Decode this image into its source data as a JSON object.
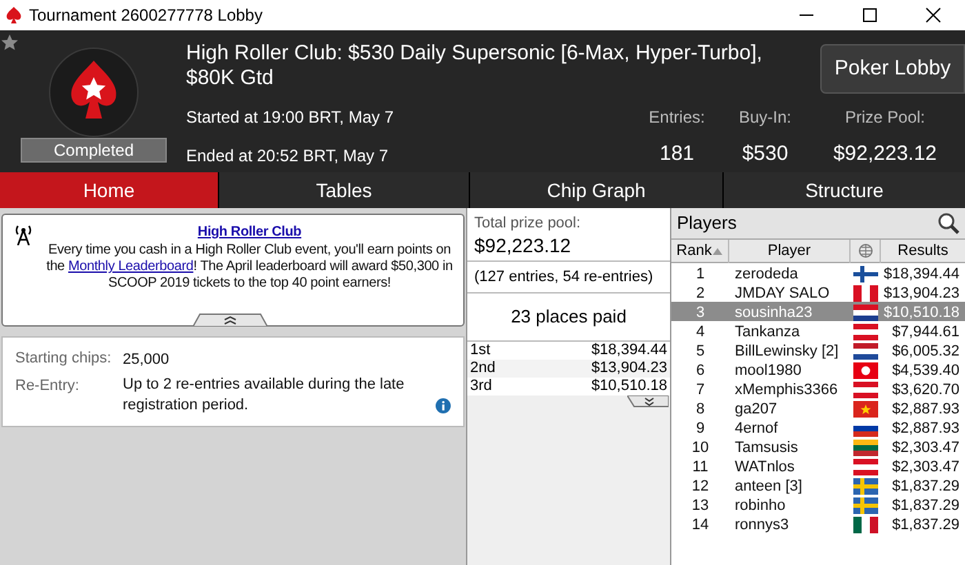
{
  "window": {
    "title": "Tournament 2600277778 Lobby"
  },
  "header": {
    "title": "High Roller Club: $530 Daily Supersonic [6-Max, Hyper-Turbo], $80K Gtd",
    "status": "Completed",
    "started": "Started at 19:00 BRT, May 7",
    "ended": "Ended at 20:52 BRT, May 7",
    "stats": [
      {
        "label": "Entries:",
        "value": "181"
      },
      {
        "label": "Buy-In:",
        "value": "$530"
      },
      {
        "label": "Prize Pool:",
        "value": "$92,223.12"
      }
    ],
    "lobby_button": "Poker Lobby"
  },
  "tabs": [
    {
      "label": "Home",
      "selected": true
    },
    {
      "label": "Tables",
      "selected": false
    },
    {
      "label": "Chip Graph",
      "selected": false
    },
    {
      "label": "Structure",
      "selected": false
    }
  ],
  "news": {
    "title": "High Roller Club",
    "parts": [
      "Every time you cash in a High Roller Club event, you'll earn points on the ",
      "Monthly Leaderboard",
      "! The April leaderboard will award $50,300 in SCOOP 2019 tickets to the top 40 point earners!"
    ]
  },
  "info": [
    {
      "label": "Starting chips:",
      "value": "25,000",
      "help": false
    },
    {
      "label": "Re-Entry:",
      "value": "Up to 2 re-entries available during the late registration period.",
      "help": true
    }
  ],
  "prizes": {
    "total_label": "Total prize pool:",
    "total": "$92,223.12",
    "entries": "(127 entries, 54 re-entries)",
    "places": "23 places paid",
    "rows": [
      {
        "place": "1st",
        "amount": "$18,394.44"
      },
      {
        "place": "2nd",
        "amount": "$13,904.23"
      },
      {
        "place": "3rd",
        "amount": "$10,510.18"
      }
    ]
  },
  "players": {
    "title": "Players",
    "columns": [
      "Rank",
      "Player",
      "Results"
    ],
    "rows": [
      {
        "rank": "1",
        "name": "zerodeda",
        "result": "$18,394.44",
        "selected": false
      },
      {
        "rank": "2",
        "name": "JMDAY SALO",
        "result": "$13,904.23",
        "selected": false
      },
      {
        "rank": "3",
        "name": "sousinha23",
        "result": "$10,510.18",
        "selected": true
      },
      {
        "rank": "4",
        "name": "Tankanza",
        "result": "$7,944.61",
        "selected": false
      },
      {
        "rank": "5",
        "name": "BillLewinsky [2]",
        "result": "$6,005.32",
        "selected": false
      },
      {
        "rank": "6",
        "name": "mool1980",
        "result": "$4,539.40",
        "selected": false
      },
      {
        "rank": "7",
        "name": "xMemphis3366",
        "result": "$3,620.70",
        "selected": false
      },
      {
        "rank": "8",
        "name": "ga207",
        "result": "$2,887.93",
        "selected": false
      },
      {
        "rank": "9",
        "name": "4ernof",
        "result": "$2,887.93",
        "selected": false
      },
      {
        "rank": "10",
        "name": "Tamsusis",
        "result": "$2,303.47",
        "selected": false
      },
      {
        "rank": "11",
        "name": "WATnlos",
        "result": "$2,303.47",
        "selected": false
      },
      {
        "rank": "12",
        "name": "anteen [3]",
        "result": "$1,837.29",
        "selected": false
      },
      {
        "rank": "13",
        "name": "robinho",
        "result": "$1,837.29",
        "selected": false
      },
      {
        "rank": "14",
        "name": "ronnys3",
        "result": "$1,837.29",
        "selected": false
      }
    ]
  }
}
